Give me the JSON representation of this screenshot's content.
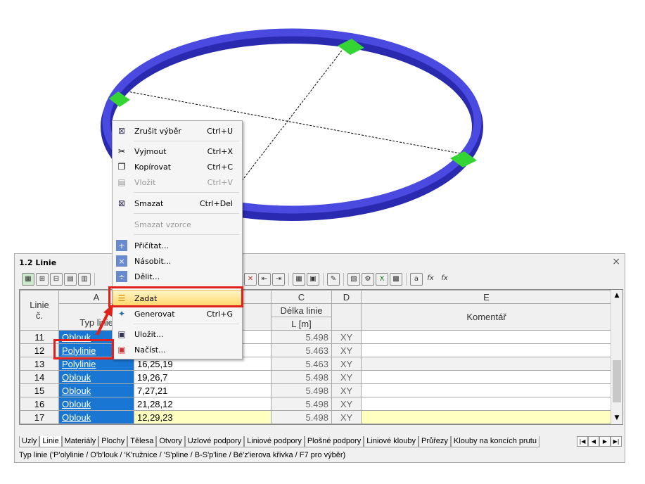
{
  "panel": {
    "title": "1.2 Linie",
    "close": "×"
  },
  "toolbar": {
    "icons": [
      "excel-export-icon",
      "insert-row-icon",
      "delete-row-icon",
      "table-icon",
      "chart-icon",
      "select-icon",
      "delete-icon",
      "move-left-icon",
      "move-right-icon",
      "grid-icon",
      "edit-icon",
      "graphics-icon",
      "settings-icon",
      "excel-icon",
      "calc-icon",
      "edit-formula-icon",
      "fx-icon",
      "fx-edit-icon"
    ]
  },
  "grid": {
    "col_letters": [
      "A",
      "C",
      "D",
      "E"
    ],
    "header": {
      "row_no": "Linie č.",
      "type": "Typ linie",
      "length_top": "Délka linie",
      "length_unit": "L [m]",
      "comment": "Komentář"
    },
    "rows": [
      {
        "no": "11",
        "type": "Oblouk",
        "nodes": "",
        "length": "5.498",
        "dir": "XY",
        "comment": ""
      },
      {
        "no": "12",
        "type": "Polylinie",
        "nodes": "",
        "length": "5.463",
        "dir": "XY",
        "comment": ""
      },
      {
        "no": "13",
        "type": "Polylinie",
        "nodes": "16,25,19",
        "length": "5.463",
        "dir": "XY",
        "comment": ""
      },
      {
        "no": "14",
        "type": "Oblouk",
        "nodes": "19,26,7",
        "length": "5.498",
        "dir": "XY",
        "comment": ""
      },
      {
        "no": "15",
        "type": "Oblouk",
        "nodes": "7,27,21",
        "length": "5.498",
        "dir": "XY",
        "comment": ""
      },
      {
        "no": "16",
        "type": "Oblouk",
        "nodes": "21,28,12",
        "length": "5.498",
        "dir": "XY",
        "comment": ""
      },
      {
        "no": "17",
        "type": "Oblouk",
        "nodes": "12,29,23",
        "length": "5.498",
        "dir": "XY",
        "comment": ""
      }
    ]
  },
  "tabs": [
    "Uzly",
    "Linie",
    "Materiály",
    "Plochy",
    "Tělesa",
    "Otvory",
    "Uzlové podpory",
    "Liniové podpory",
    "Plošné podpory",
    "Liniové klouby",
    "Průřezy",
    "Klouby na koncích prutu"
  ],
  "status": "Typ linie ('P'olylinie / O'b'louk / 'K'ružnice / 'S'pline / B-S'p'line / Bé'z'ierova křivka / F7 pro výběr)",
  "menu": {
    "undo_select": {
      "label": "Zrušit výběr",
      "shortcut": "Ctrl+U"
    },
    "cut": {
      "label": "Vyjmout",
      "shortcut": "Ctrl+X"
    },
    "copy": {
      "label": "Kopírovat",
      "shortcut": "Ctrl+C"
    },
    "paste": {
      "label": "Vložit",
      "shortcut": "Ctrl+V"
    },
    "delete": {
      "label": "Smazat",
      "shortcut": "Ctrl+Del"
    },
    "delete_formula": {
      "label": "Smazat vzorce"
    },
    "add": {
      "label": "Přičítat..."
    },
    "multiply": {
      "label": "Násobit..."
    },
    "divide": {
      "label": "Dělit..."
    },
    "enter": {
      "label": "Zadat"
    },
    "generate": {
      "label": "Generovat",
      "shortcut": "Ctrl+G"
    },
    "save": {
      "label": "Uložit..."
    },
    "load": {
      "label": "Načíst..."
    }
  },
  "colors": {
    "ring": "#4040d8",
    "support": "#33d433",
    "selection": "#1976d2",
    "highlight": "#e0201a"
  }
}
